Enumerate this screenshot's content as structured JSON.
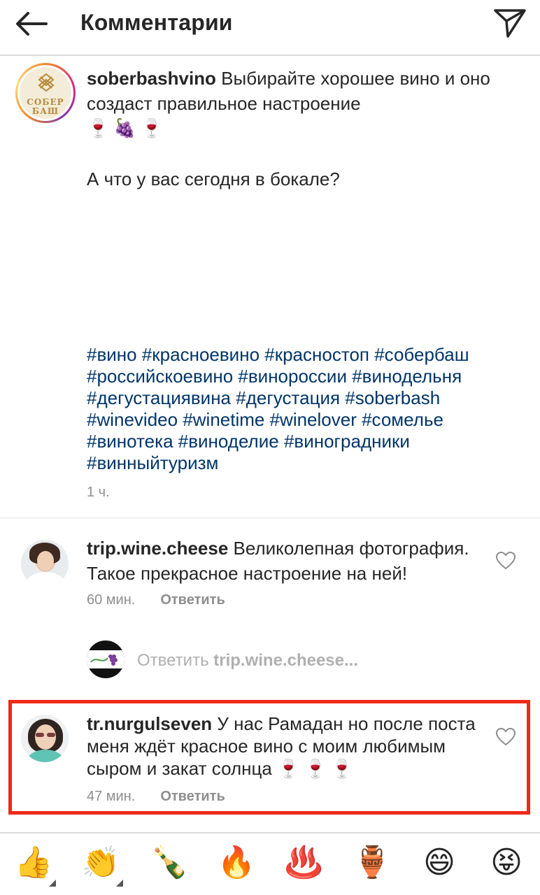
{
  "header": {
    "title": "Комментарии",
    "back_icon": "arrow-left-icon",
    "send_icon": "paper-plane-icon"
  },
  "caption": {
    "username": "soberbashvino",
    "text": "Выбирайте хорошее вино и оно создаст правильное настроение",
    "emojis": "🍷🍇🍷",
    "question": "А что у вас сегодня в бокале?",
    "hashtags": [
      "#вино #красноевино #красностоп #собербаш",
      "#российскоевино #винороссии #винодельня",
      "#дегустациявина #дегустация #soberbash",
      "#winevideo #winetime #winelover #сомелье",
      "#винотека #виноделие #виноградники",
      "#винныйтуризм"
    ],
    "time": "1 ч.",
    "logo_text_top": "СОБЕР",
    "logo_text_bottom": "БАШ"
  },
  "comments": [
    {
      "username": "trip.wine.cheese",
      "text": "Великолепная фотография. Такое прекрасное настроение на ней!",
      "time": "60 мин.",
      "reply_label": "Ответить"
    },
    {
      "username": "tr.nurgulseven",
      "text": "У нас Рамадан но после поста меня ждёт красное вино с моим любимым сыром и закат солнца",
      "emojis": "🍷🍷🍷",
      "time": "47 мин.",
      "reply_label": "Ответить"
    }
  ],
  "reply_box": {
    "prefix": "Ответить",
    "target": "trip.wine.cheese..."
  },
  "quick_emojis": [
    "👍",
    "👏",
    "🍾",
    "🔥",
    "♨️",
    "🏺",
    "😄",
    "😝"
  ],
  "colors": {
    "hashtag": "#003569",
    "highlight_border": "#ef2a17",
    "meta_text": "#8e8e8e"
  }
}
